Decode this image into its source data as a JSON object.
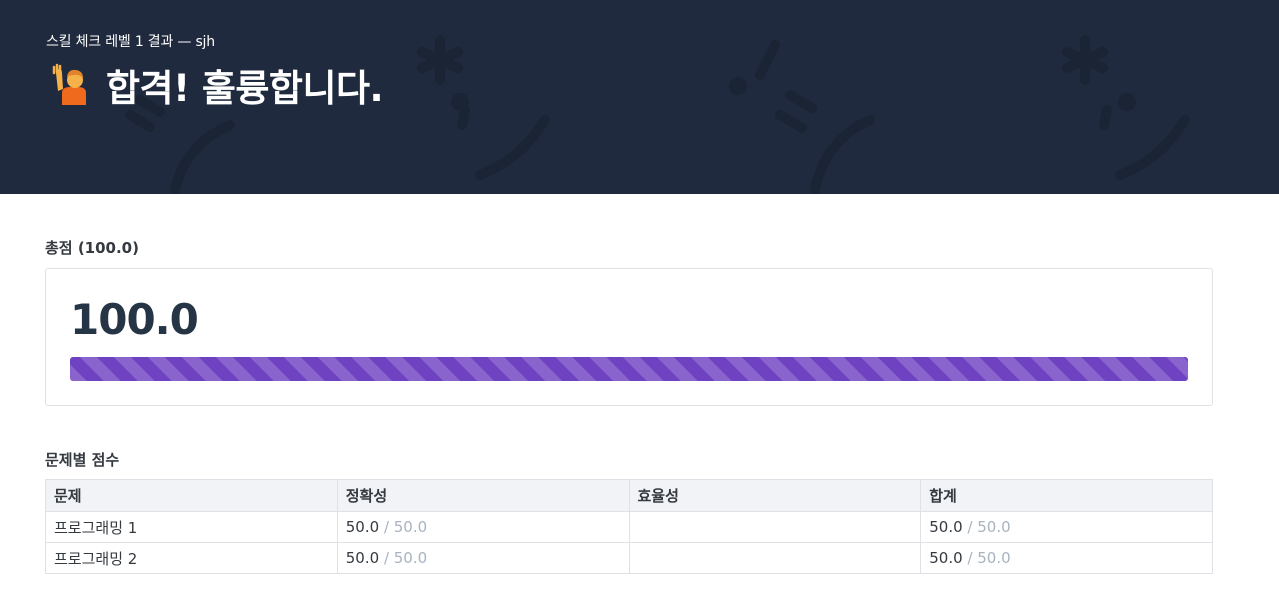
{
  "header": {
    "subtitle": "스킬 체크 레벨 1 결과 — sjh",
    "title": "합격! 훌륭합니다.",
    "emoji_icon": "person-raising-hand-icon"
  },
  "total": {
    "label": "총점 (100.0)",
    "value": "100.0",
    "progress_fraction": 1.0,
    "progress_color": "#6f42c1"
  },
  "problems": {
    "label": "문제별 점수",
    "columns": [
      "문제",
      "정확성",
      "효율성",
      "합계"
    ],
    "rows": [
      {
        "name": "프로그래밍 1",
        "accuracy": "50.0",
        "accuracy_max": "/ 50.0",
        "efficiency": "",
        "total": "50.0",
        "total_max": "/ 50.0"
      },
      {
        "name": "프로그래밍 2",
        "accuracy": "50.0",
        "accuracy_max": "/ 50.0",
        "efficiency": "",
        "total": "50.0",
        "total_max": "/ 50.0"
      }
    ]
  },
  "colors": {
    "header_bg": "#202a3e",
    "table_header_bg": "#f2f3f7",
    "muted_text": "#a8b3c0"
  }
}
